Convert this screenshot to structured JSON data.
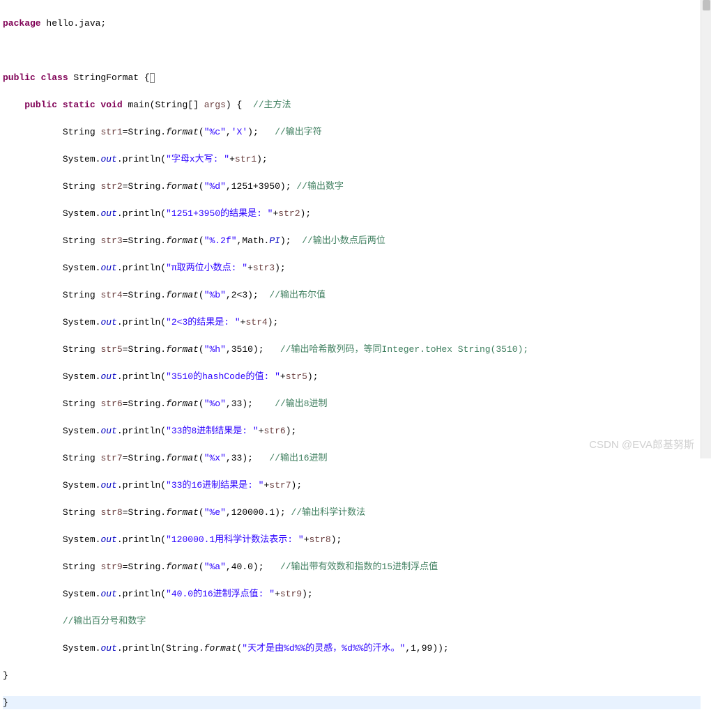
{
  "code": {
    "l1": {
      "kw1": "package",
      "pkg": " hello.java;"
    },
    "l2": {},
    "l3": {
      "kw1": "public class",
      "cls": " StringFormat ",
      "brace": "{"
    },
    "l4": {
      "indent": "    ",
      "kw1": "public static void",
      "name": " main(String[] ",
      "param": "args",
      "rest": ") {  ",
      "com": "//主方法"
    },
    "l5": {
      "indent": "           String ",
      "var": "str1",
      "eq": "=String.",
      "method": "format",
      "open": "(",
      "s1": "\"%c\"",
      "mid": ",",
      "s2": "'X'",
      "close": ");   ",
      "com": "//输出字符"
    },
    "l6": {
      "indent": "           System.",
      "out": "out",
      "dot": ".println(",
      "s1": "\"字母x大写: \"",
      "rest": "+",
      "var": "str1",
      "close": ");"
    },
    "l7": {
      "indent": "           String ",
      "var": "str2",
      "eq": "=String.",
      "method": "format",
      "open": "(",
      "s1": "\"%d\"",
      "mid": ",1251+3950); ",
      "com": "//输出数字"
    },
    "l8": {
      "indent": "           System.",
      "out": "out",
      "dot": ".println(",
      "s1": "\"1251+3950的结果是: \"",
      "rest": "+",
      "var": "str2",
      "close": ");"
    },
    "l9": {
      "indent": "           String ",
      "var": "str3",
      "eq": "=String.",
      "method": "format",
      "open": "(",
      "s1": "\"%.2f\"",
      "mid": ",Math.",
      "pi": "PI",
      "close": ");  ",
      "com": "//输出小数点后两位"
    },
    "l10": {
      "indent": "           System.",
      "out": "out",
      "dot": ".println(",
      "s1": "\"π取两位小数点: \"",
      "rest": "+",
      "var": "str3",
      "close": ");"
    },
    "l11": {
      "indent": "           String ",
      "var": "str4",
      "eq": "=String.",
      "method": "format",
      "open": "(",
      "s1": "\"%b\"",
      "mid": ",2<3);  ",
      "com": "//输出布尔值"
    },
    "l12": {
      "indent": "           System.",
      "out": "out",
      "dot": ".println(",
      "s1": "\"2<3的结果是: \"",
      "rest": "+",
      "var": "str4",
      "close": ");"
    },
    "l13": {
      "indent": "           String ",
      "var": "str5",
      "eq": "=String.",
      "method": "format",
      "open": "(",
      "s1": "\"%h\"",
      "mid": ",3510);   ",
      "com": "//输出哈希散列码，等同Integer.toHex String(3510);"
    },
    "l14": {
      "indent": "           System.",
      "out": "out",
      "dot": ".println(",
      "s1": "\"3510的hashCode的值: \"",
      "rest": "+",
      "var": "str5",
      "close": ");"
    },
    "l15": {
      "indent": "           String ",
      "var": "str6",
      "eq": "=String.",
      "method": "format",
      "open": "(",
      "s1": "\"%o\"",
      "mid": ",33);    ",
      "com": "//输出8进制"
    },
    "l16": {
      "indent": "           System.",
      "out": "out",
      "dot": ".println(",
      "s1": "\"33的8进制结果是: \"",
      "rest": "+",
      "var": "str6",
      "close": ");"
    },
    "l17": {
      "indent": "           String ",
      "var": "str7",
      "eq": "=String.",
      "method": "format",
      "open": "(",
      "s1": "\"%x\"",
      "mid": ",33);   ",
      "com": "//输出16进制"
    },
    "l18": {
      "indent": "           System.",
      "out": "out",
      "dot": ".println(",
      "s1": "\"33的16进制结果是: \"",
      "rest": "+",
      "var": "str7",
      "close": ");"
    },
    "l19": {
      "indent": "           String ",
      "var": "str8",
      "eq": "=String.",
      "method": "format",
      "open": "(",
      "s1": "\"%e\"",
      "mid": ",120000.1); ",
      "com": "//输出科学计数法"
    },
    "l20": {
      "indent": "           System.",
      "out": "out",
      "dot": ".println(",
      "s1": "\"120000.1用科学计数法表示: \"",
      "rest": "+",
      "var": "str8",
      "close": ");"
    },
    "l21": {
      "indent": "           String ",
      "var": "str9",
      "eq": "=String.",
      "method": "format",
      "open": "(",
      "s1": "\"%a\"",
      "mid": ",40.0);   ",
      "com": "//输出带有效数和指数的15进制浮点值"
    },
    "l22": {
      "indent": "           System.",
      "out": "out",
      "dot": ".println(",
      "s1": "\"40.0的16进制浮点值: \"",
      "rest": "+",
      "var": "str9",
      "close": ");"
    },
    "l23": {
      "indent": "           ",
      "com": "//输出百分号和数字"
    },
    "l24": {
      "indent": "           System.",
      "out": "out",
      "dot": ".println(String.",
      "method": "format",
      "open": "(",
      "s1": "\"天才是由%d%%的灵感，%d%%的汗水。\"",
      "mid": ",1,99));"
    },
    "l25": {
      "text": "}"
    },
    "l26": {
      "text": "}"
    }
  },
  "watermark": "CSDN @EVA郎基努斯"
}
